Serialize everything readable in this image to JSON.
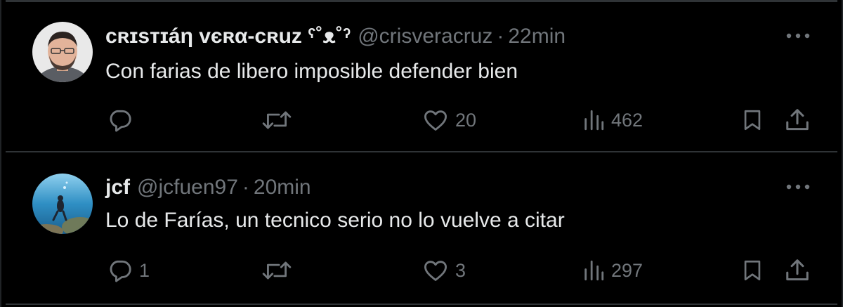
{
  "tweets": [
    {
      "name": "ᴄʀɪsᴛɪáη ᴠєʀα-ᴄʀuz ˁ˚ᴥ˚ˀ",
      "handle": "@crisveracruz",
      "separator": "·",
      "time": "22min",
      "text": "Con farias de libero imposible defender bien",
      "replies": "",
      "retweets": "",
      "likes": "20",
      "views": "462"
    },
    {
      "name": "jcf",
      "handle": "@jcfuen97",
      "separator": "·",
      "time": "20min",
      "text": "Lo de Farías, un tecnico serio no lo vuelve a citar",
      "replies": "1",
      "retweets": "",
      "likes": "3",
      "views": "297"
    }
  ],
  "icons": {
    "reply": "reply-icon",
    "retweet": "retweet-icon",
    "like": "heart-icon",
    "views": "views-icon",
    "bookmark": "bookmark-icon",
    "share": "share-icon",
    "more": "more-icon"
  },
  "colors": {
    "background": "#000000",
    "text": "#e7e9ea",
    "muted": "#71767b",
    "border": "#2f3336"
  }
}
